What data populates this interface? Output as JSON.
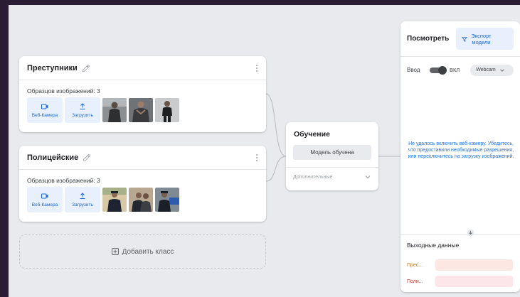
{
  "classes": [
    {
      "name": "Преступники",
      "samples_label": "Образцов изображений: 3",
      "webcam_label": "Веб-Камера",
      "upload_label": "Загрузить"
    },
    {
      "name": "Полицейские",
      "samples_label": "Образцов изображений: 3",
      "webcam_label": "Веб-Камера",
      "upload_label": "Загрузить"
    }
  ],
  "add_class_label": "Добавить класс",
  "training": {
    "title": "Обучение",
    "button_label": "Модель обучена",
    "advanced_label": "Дополнительные"
  },
  "preview": {
    "title": "Посмотреть",
    "export_label_line1": "Экспорт",
    "export_label_line2": "модели",
    "input_label": "Ввод",
    "toggle_state": "ВКЛ",
    "source_select": "Webcam",
    "camera_error": "Не удалось включить веб-камеру. Убедитесь, что предоставили необходимые разрешения, или переключитесь на загрузку изображений.",
    "output_title": "Выходные данные",
    "outputs": [
      {
        "label": "Прес...",
        "color": "#e37400",
        "bar_color": "#fde7e3"
      },
      {
        "label": "Поли...",
        "color": "#d93025",
        "bar_color": "#fce6ea"
      }
    ]
  },
  "colors": {
    "accent": "#1a73e8",
    "frame": "#2a1d33",
    "canvas": "#e8eaed"
  },
  "icons": [
    "pencil-icon",
    "more-vert-icon",
    "webcam-icon",
    "upload-icon",
    "add-box-icon",
    "chevron-down-icon",
    "export-icon",
    "arrow-down-icon"
  ]
}
